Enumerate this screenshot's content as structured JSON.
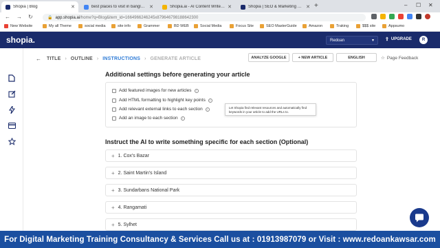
{
  "browser": {
    "tabs": [
      {
        "label": "Shopia | Blog",
        "color": "#1a2b6b",
        "active": true
      },
      {
        "label": "best places to visit in bangladesh",
        "color": "#4285f4",
        "active": false
      },
      {
        "label": "Shopia.ai - AI Content Writer, Sc",
        "color": "#f4b400",
        "active": false
      },
      {
        "label": "Shopia | SEO & Marketing Conte",
        "color": "#1a2b6b",
        "active": false
      }
    ],
    "new_tab": "+",
    "url_host": "app.shopia.ai",
    "url_path": "/home?q=Blog&item_id=1664966246245x879646798188642300",
    "window_controls": [
      "–",
      "☐",
      "✕"
    ]
  },
  "bookmarks": [
    {
      "label": "New Website",
      "color": "#e94235"
    },
    {
      "label": "My all Theme",
      "color": "#e9a135"
    },
    {
      "label": "social media",
      "color": "#e9a135"
    },
    {
      "label": "site info",
      "color": "#e9a135"
    },
    {
      "label": "Grammer",
      "color": "#e9a135"
    },
    {
      "label": "BD WEB",
      "color": "#e9a135"
    },
    {
      "label": "Social Media",
      "color": "#e9a135"
    },
    {
      "label": "Focus Site",
      "color": "#e9a135"
    },
    {
      "label": "SEO MasterGuide",
      "color": "#e9a135"
    },
    {
      "label": "Amazon",
      "color": "#e9a135"
    },
    {
      "label": "Traking",
      "color": "#e9a135"
    },
    {
      "label": "$$$ site",
      "color": "#e9a135"
    },
    {
      "label": "Appsumo",
      "color": "#e9a135"
    }
  ],
  "app": {
    "logo": "shopia.",
    "user_select": "Redoan",
    "upgrade": "UPGRADE",
    "avatar_initial": "R",
    "brand_color": "#1a2b6b",
    "accent_color": "#2e7bd6"
  },
  "sidebar_icons": [
    "document-icon",
    "edit-icon",
    "bolt-icon",
    "card-icon",
    "star-icon"
  ],
  "steps": [
    {
      "label": "TITLE",
      "state": "done"
    },
    {
      "label": "OUTLINE",
      "state": "done"
    },
    {
      "label": "INSTRUCTIONS",
      "state": "active"
    },
    {
      "label": "GENERATE ARTICLE",
      "state": "pending"
    }
  ],
  "actions": {
    "analyze": "ANALYZE GOOGLE",
    "new_article": "+ NEW ARTICLE",
    "language": "ENGLISH",
    "feedback": "Page Feedback"
  },
  "settings": {
    "heading": "Additional settings before generating your article",
    "options": [
      "Add featured images for new articles",
      "Add HTML formatting to highlight key points",
      "Add relevant external links to each section",
      "Add an image to each section"
    ],
    "tooltip": "Let Shopia find relevant resources and automatically find keywords in your article to add the URLs to."
  },
  "instructions": {
    "heading": "Instruct the AI to write something specific for each section (Optional)",
    "sections": [
      "1. Cox's Bazar",
      "2. Saint Martin's Island",
      "3. Sundarbans National Park",
      "4. Rangamati",
      "5. Sylhet"
    ]
  },
  "banner": "For Digital Marketing Training Consultancy & Services Call us at : 01913987079 or Visit : www.redoankawsar.com"
}
